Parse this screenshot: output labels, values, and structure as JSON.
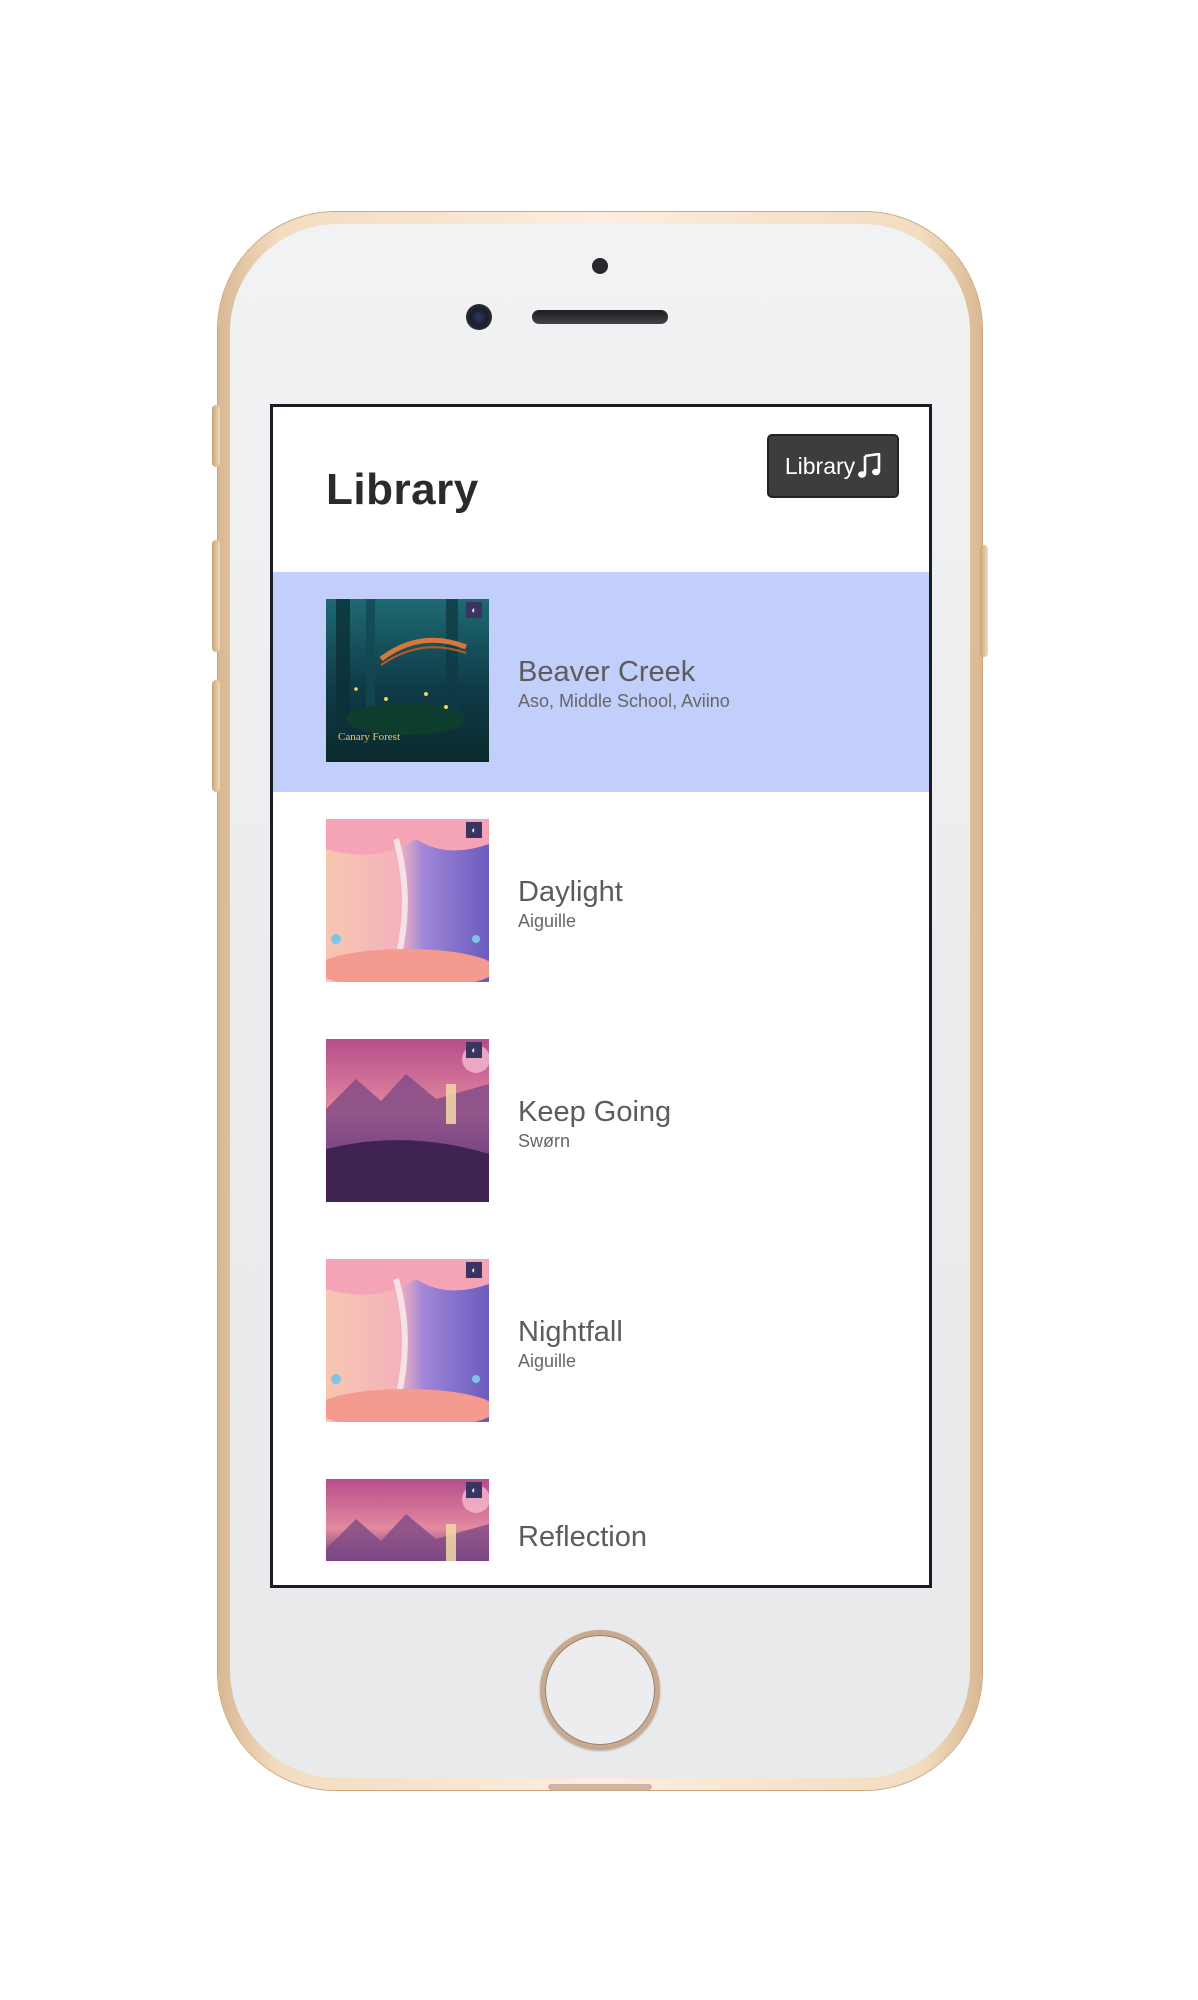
{
  "header": {
    "title": "Library",
    "library_button_label": "Library",
    "library_button_icon": "music-note-icon"
  },
  "tracks": [
    {
      "title": "Beaver Creek",
      "artist": "Aso, Middle School, Aviino",
      "active": true,
      "cover_text": "Canary Forest"
    },
    {
      "title": "Daylight",
      "artist": "Aiguille",
      "active": false
    },
    {
      "title": "Keep Going",
      "artist": "Swørn",
      "active": false
    },
    {
      "title": "Nightfall",
      "artist": "Aiguille",
      "active": false
    },
    {
      "title": "Reflection",
      "artist": "",
      "active": false
    }
  ],
  "colors": {
    "active_row": "#c3cffb",
    "button_bg": "#3d3d3d",
    "title_text": "#2b2b2b",
    "track_text": "#5c5c5c"
  }
}
